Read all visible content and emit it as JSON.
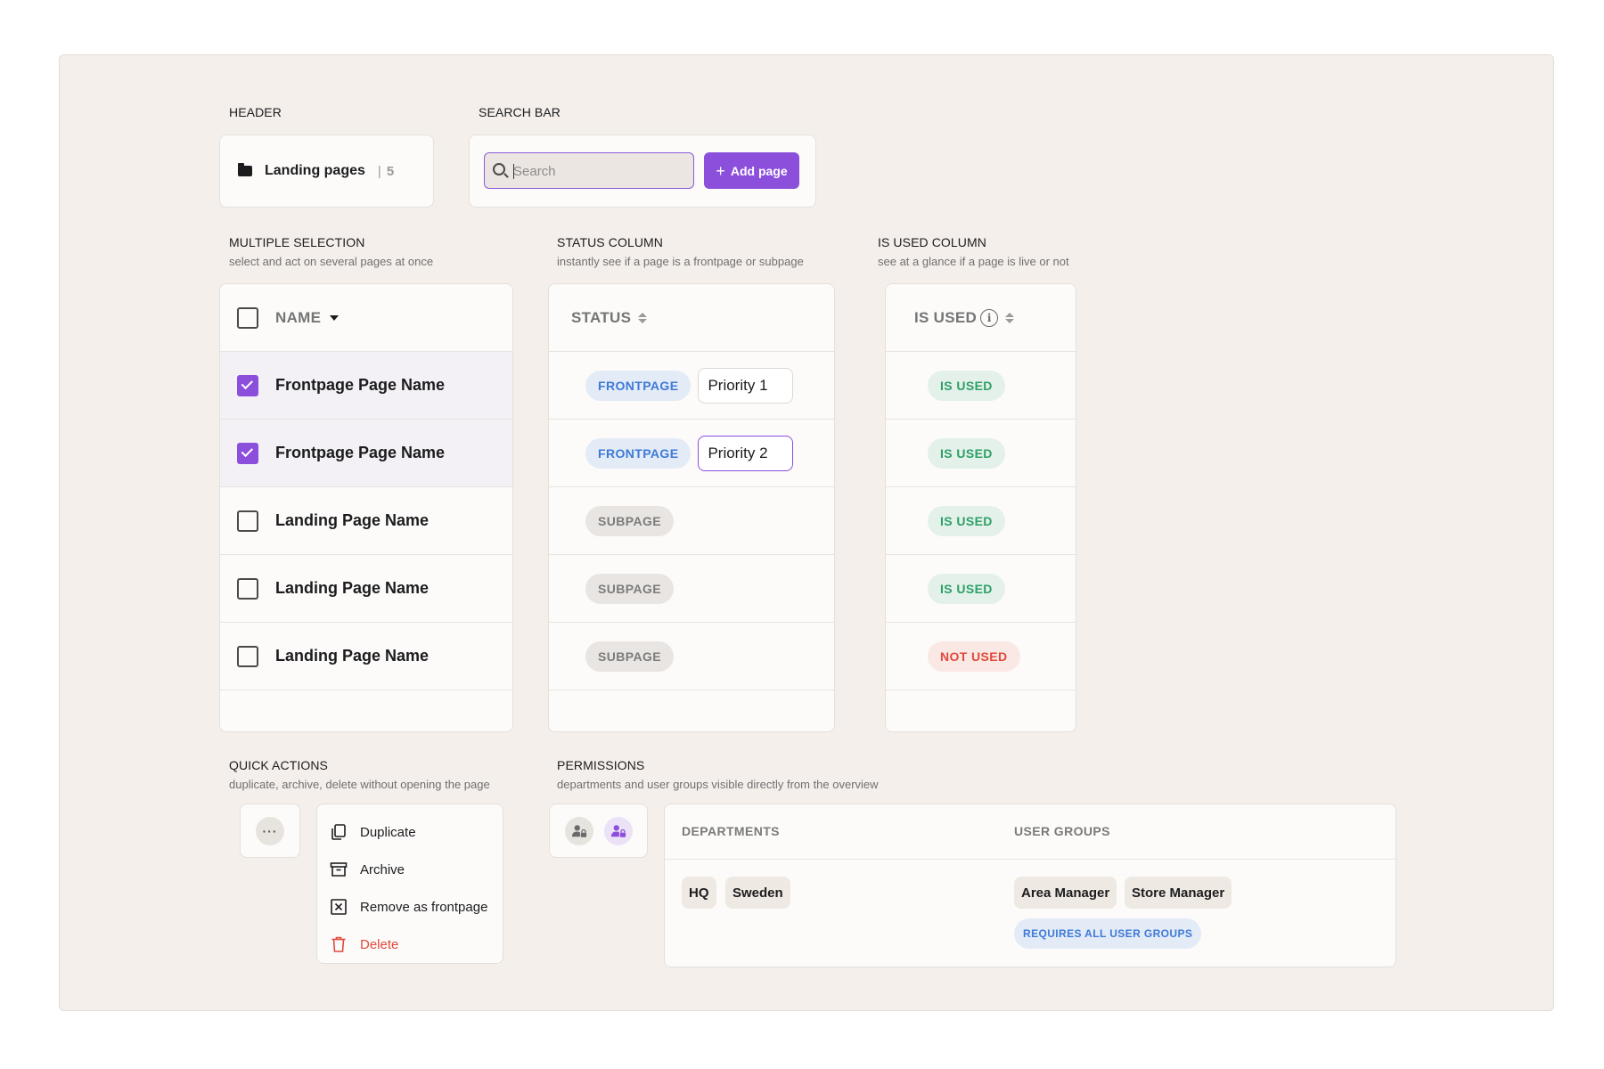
{
  "colors": {
    "accent": "#8c4fdc",
    "canvas_bg": "#f4efeb",
    "frontpage_text": "#3e7ad8",
    "used_text": "#2ea066",
    "not_used_text": "#e0493b"
  },
  "sections": {
    "header": {
      "title": "HEADER"
    },
    "search": {
      "title": "SEARCH BAR"
    },
    "multi": {
      "title": "MULTIPLE SELECTION",
      "subtitle": "select and act on several pages at once"
    },
    "status": {
      "title": "STATUS COLUMN",
      "subtitle": "instantly see if a page is a frontpage or subpage"
    },
    "used": {
      "title": "IS USED COLUMN",
      "subtitle": "see at a glance if a page is live or not"
    },
    "quick": {
      "title": "QUICK ACTIONS",
      "subtitle": "duplicate, archive, delete without opening the page"
    },
    "perm": {
      "title": "PERMISSIONS",
      "subtitle": "departments and user groups visible directly from the overview"
    }
  },
  "header": {
    "icon": "folder-icon",
    "title": "Landing pages",
    "separator": "|",
    "count": "5"
  },
  "search": {
    "placeholder": "Search",
    "add_label": "Add page"
  },
  "name_table": {
    "header": "NAME",
    "rows": [
      {
        "name": "Frontpage Page Name",
        "checked": true
      },
      {
        "name": "Frontpage Page Name",
        "checked": true
      },
      {
        "name": "Landing Page Name",
        "checked": false
      },
      {
        "name": "Landing Page Name",
        "checked": false
      },
      {
        "name": "Landing Page Name",
        "checked": false
      }
    ]
  },
  "status_table": {
    "header": "STATUS",
    "rows": [
      {
        "status": "FRONTPAGE",
        "priority": "Priority 1"
      },
      {
        "status": "FRONTPAGE",
        "priority": "Priority 2"
      },
      {
        "status": "SUBPAGE"
      },
      {
        "status": "SUBPAGE"
      },
      {
        "status": "SUBPAGE"
      }
    ]
  },
  "used_table": {
    "header": "IS USED",
    "info_icon": "i",
    "rows": [
      "IS USED",
      "IS USED",
      "IS USED",
      "IS USED",
      "NOT USED"
    ]
  },
  "quick_actions": {
    "menu_icon": "···",
    "items": [
      {
        "label": "Duplicate",
        "icon": "copy-icon"
      },
      {
        "label": "Archive",
        "icon": "archive-icon"
      },
      {
        "label": "Remove as frontpage",
        "icon": "close-box-icon"
      },
      {
        "label": "Delete",
        "icon": "trash-icon"
      }
    ]
  },
  "permissions": {
    "departments_header": "DEPARTMENTS",
    "user_groups_header": "USER GROUPS",
    "departments": [
      "HQ",
      "Sweden"
    ],
    "user_groups": [
      "Area Manager",
      "Store Manager"
    ],
    "requires_all": "REQUIRES ALL USER GROUPS"
  }
}
